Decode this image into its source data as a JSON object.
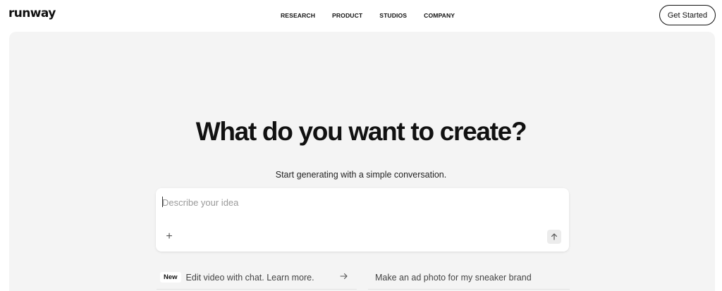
{
  "header": {
    "logo": "runway",
    "nav": [
      "RESEARCH",
      "PRODUCT",
      "STUDIOS",
      "COMPANY"
    ],
    "cta_label": "Get Started"
  },
  "hero": {
    "headline": "What do you want to create?",
    "subheadline": "Start generating with a simple conversation.",
    "prompt": {
      "placeholder": "Describe your idea",
      "value": ""
    },
    "suggestions": [
      {
        "badge": "New",
        "text": "Edit video with chat. Learn more."
      },
      {
        "text": "Make an ad photo for my sneaker brand"
      }
    ]
  },
  "colors": {
    "hero_bg": "#f4f4f4",
    "text": "#111111",
    "placeholder": "#9a9a9a"
  },
  "icons": [
    "plus-icon",
    "arrow-up-icon",
    "arrow-right-icon"
  ]
}
